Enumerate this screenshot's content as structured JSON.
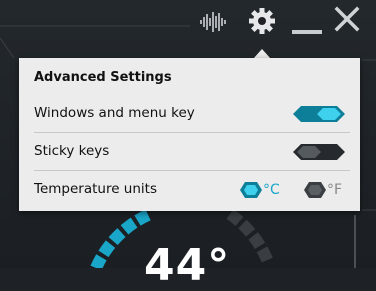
{
  "titlebar": {
    "icons": [
      "equalizer-icon",
      "gear-icon",
      "minimize-icon",
      "close-icon"
    ]
  },
  "panel": {
    "title": "Advanced Settings",
    "rows": [
      {
        "label": "Windows and menu key",
        "state": "on"
      },
      {
        "label": "Sticky keys",
        "state": "off"
      },
      {
        "label": "Temperature units"
      }
    ],
    "units": {
      "celsius": {
        "symbol": "°C",
        "selected": true
      },
      "fahrenheit": {
        "symbol": "°F",
        "selected": false
      }
    }
  },
  "gauge": {
    "reading": "44°"
  },
  "colors": {
    "accent": "#1aa6c8",
    "dark": "#2b2f33",
    "panel": "#ececec"
  }
}
